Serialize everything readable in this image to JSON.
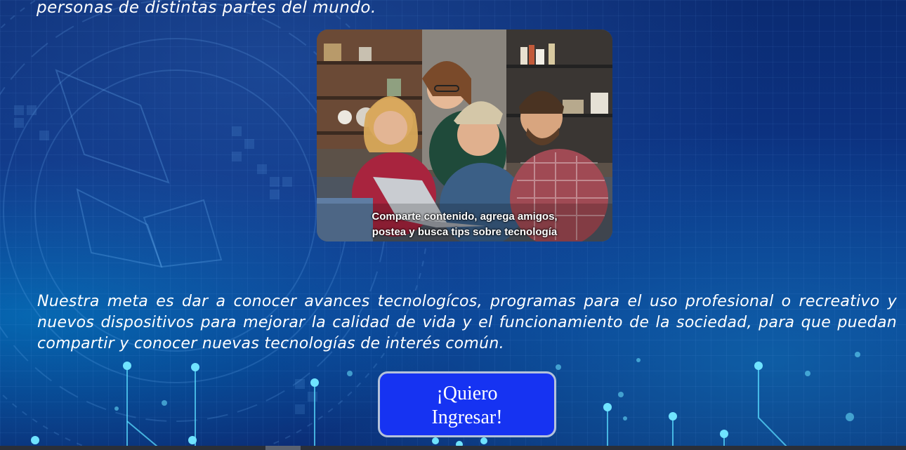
{
  "intro": {
    "text": "personas de distintas partes del mundo."
  },
  "photo": {
    "caption_line1": "Comparte contenido, agrega amigos,",
    "caption_line2": "postea y busca tips sobre tecnología"
  },
  "mission": {
    "text": "Nuestra meta es dar a conocer avances tecnologícos, programas para el uso profesional o recreativo y nuevos dispositivos para mejorar la calidad de vida y el funcionamiento de la sociedad, para que puedan compartir y conocer nuevas tecnologías de interés común."
  },
  "cta": {
    "line1": "¡Quiero",
    "line2": "Ingresar!"
  },
  "colors": {
    "background": "#0c3587",
    "button": "#1633f2",
    "button_border": "#b4c2da",
    "text": "#ffffff"
  }
}
